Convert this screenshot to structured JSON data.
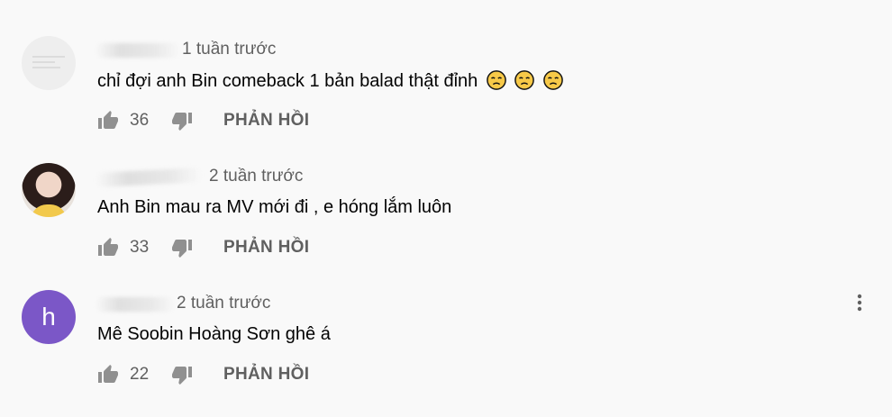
{
  "comments": [
    {
      "time": "1 tuần trước",
      "text": "chỉ đợi anh Bin comeback 1 bản balad thật đỉnh",
      "emoji_count": 3,
      "likes": "36",
      "reply_label": "PHẢN HỒI",
      "avatar_type": "blank"
    },
    {
      "time": "2 tuần trước",
      "text": "Anh Bin mau ra MV mới đi , e hóng lắm luôn",
      "likes": "33",
      "reply_label": "PHẢN HỒI",
      "avatar_type": "photo"
    },
    {
      "time": "2 tuần trước",
      "text": "Mê Soobin Hoàng Sơn ghê á",
      "likes": "22",
      "reply_label": "PHẢN HỒI",
      "avatar_type": "letter",
      "avatar_letter": "h",
      "avatar_color": "#7b57c7"
    }
  ],
  "icons": {
    "like": "thumbs-up-icon",
    "dislike": "thumbs-down-icon",
    "menu": "more-vert-icon",
    "emoji": "pleading-face-emoji"
  }
}
